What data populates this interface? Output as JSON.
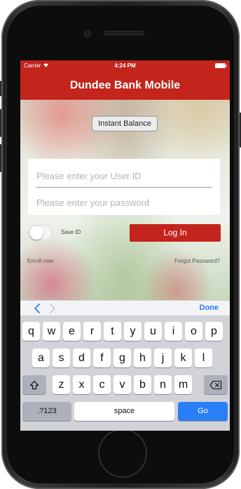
{
  "status_bar": {
    "carrier": "Carrier",
    "time": "4:24 PM"
  },
  "header": {
    "title": "Dundee Bank Mobile"
  },
  "instant_balance": {
    "label": "Instant Balance"
  },
  "login": {
    "user_id_placeholder": "Please enter your User ID",
    "user_id_value": "",
    "password_placeholder": "Please enter your password",
    "password_value": "",
    "save_id_label": "Save ID",
    "save_id_on": false,
    "login_button": "Log In"
  },
  "links": {
    "enroll": "Enroll now",
    "forgot": "Forgot Password?"
  },
  "keyboard_toolbar": {
    "done": "Done"
  },
  "keyboard": {
    "row1": [
      "q",
      "w",
      "e",
      "r",
      "t",
      "y",
      "u",
      "i",
      "o",
      "p"
    ],
    "row2": [
      "a",
      "s",
      "d",
      "f",
      "g",
      "h",
      "j",
      "k",
      "l"
    ],
    "row3": [
      "z",
      "x",
      "c",
      "v",
      "b",
      "n",
      "m"
    ],
    "numbers_key": ".?123",
    "space_key": "space",
    "go_key": "Go"
  },
  "colors": {
    "brand_red": "#c3241c",
    "ios_blue": "#2a7ff6"
  },
  "icons": [
    "wifi-icon",
    "battery-icon",
    "chevron-left-icon",
    "chevron-right-icon",
    "shift-icon",
    "backspace-icon"
  ]
}
